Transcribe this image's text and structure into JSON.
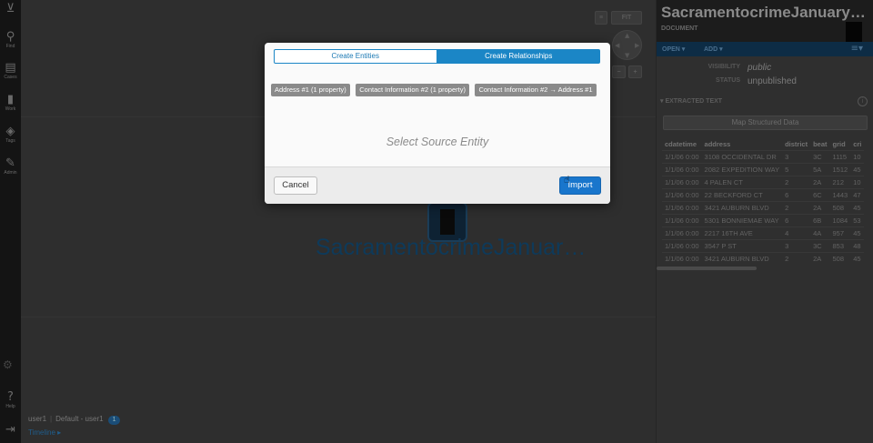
{
  "leftnav": {
    "items": [
      {
        "icon": "search-icon",
        "glyph": "⚲",
        "label": "Find"
      },
      {
        "icon": "briefcase-icon",
        "glyph": "▤",
        "label": "Cases"
      },
      {
        "icon": "book-icon",
        "glyph": "▮",
        "label": "Work"
      },
      {
        "icon": "tag-icon",
        "glyph": "◈",
        "label": "Tags"
      },
      {
        "icon": "wrench-icon",
        "glyph": "✎",
        "label": "Admin"
      },
      {
        "icon": "help-icon",
        "glyph": "?",
        "label": "Help"
      },
      {
        "icon": "logout-icon",
        "glyph": "⇥",
        "label": ""
      }
    ]
  },
  "graph": {
    "fit_label": "FIT",
    "zoom_out": "−",
    "zoom_in": "+",
    "node_label": "SacramentocrimeJanuar…"
  },
  "footer": {
    "user": "user1",
    "workspace": "Default - user1",
    "badge": "1",
    "timeline": "Timeline ▸"
  },
  "detail": {
    "title": "SacramentocrimeJanuary2006…",
    "subtitle": "DOCUMENT",
    "menu_open": "OPEN ▾",
    "menu_add": "ADD ▾",
    "props": [
      {
        "key": "VISIBILITY",
        "value": "public"
      },
      {
        "key": "STATUS",
        "value": "unpublished"
      }
    ],
    "section": "▾ EXTRACTED TEXT",
    "map_button": "Map Structured Data",
    "columns": [
      "cdatetime",
      "address",
      "district",
      "beat",
      "grid",
      "cri"
    ],
    "rows": [
      [
        "1/1/06 0:00",
        "3108 OCCIDENTAL DR",
        "3",
        "3C",
        "1115",
        "10"
      ],
      [
        "1/1/06 0:00",
        "2082 EXPEDITION WAY",
        "5",
        "5A",
        "1512",
        "45"
      ],
      [
        "1/1/06 0:00",
        "4 PALEN CT",
        "2",
        "2A",
        "212",
        "10"
      ],
      [
        "1/1/06 0:00",
        "22 BECKFORD CT",
        "6",
        "6C",
        "1443",
        "47"
      ],
      [
        "1/1/06 0:00",
        "3421 AUBURN BLVD",
        "2",
        "2A",
        "508",
        "45"
      ],
      [
        "1/1/06 0:00",
        "5301 BONNIEMAE WAY",
        "6",
        "6B",
        "1084",
        "53"
      ],
      [
        "1/1/06 0:00",
        "2217 16TH AVE",
        "4",
        "4A",
        "957",
        "45"
      ],
      [
        "1/1/06 0:00",
        "3547 P ST",
        "3",
        "3C",
        "853",
        "48"
      ],
      [
        "1/1/06 0:00",
        "3421 AUBURN BLVD",
        "2",
        "2A",
        "508",
        "45"
      ]
    ]
  },
  "modal": {
    "tab_entities": "Create Entities",
    "tab_relationships": "Create Relationships",
    "tags": [
      "Address #1 (1 property)",
      "Contact Information #2 (1 property)",
      "Contact Information #2 → Address #1"
    ],
    "placeholder": "Select Source Entity",
    "cancel": "Cancel",
    "import": "Import"
  }
}
